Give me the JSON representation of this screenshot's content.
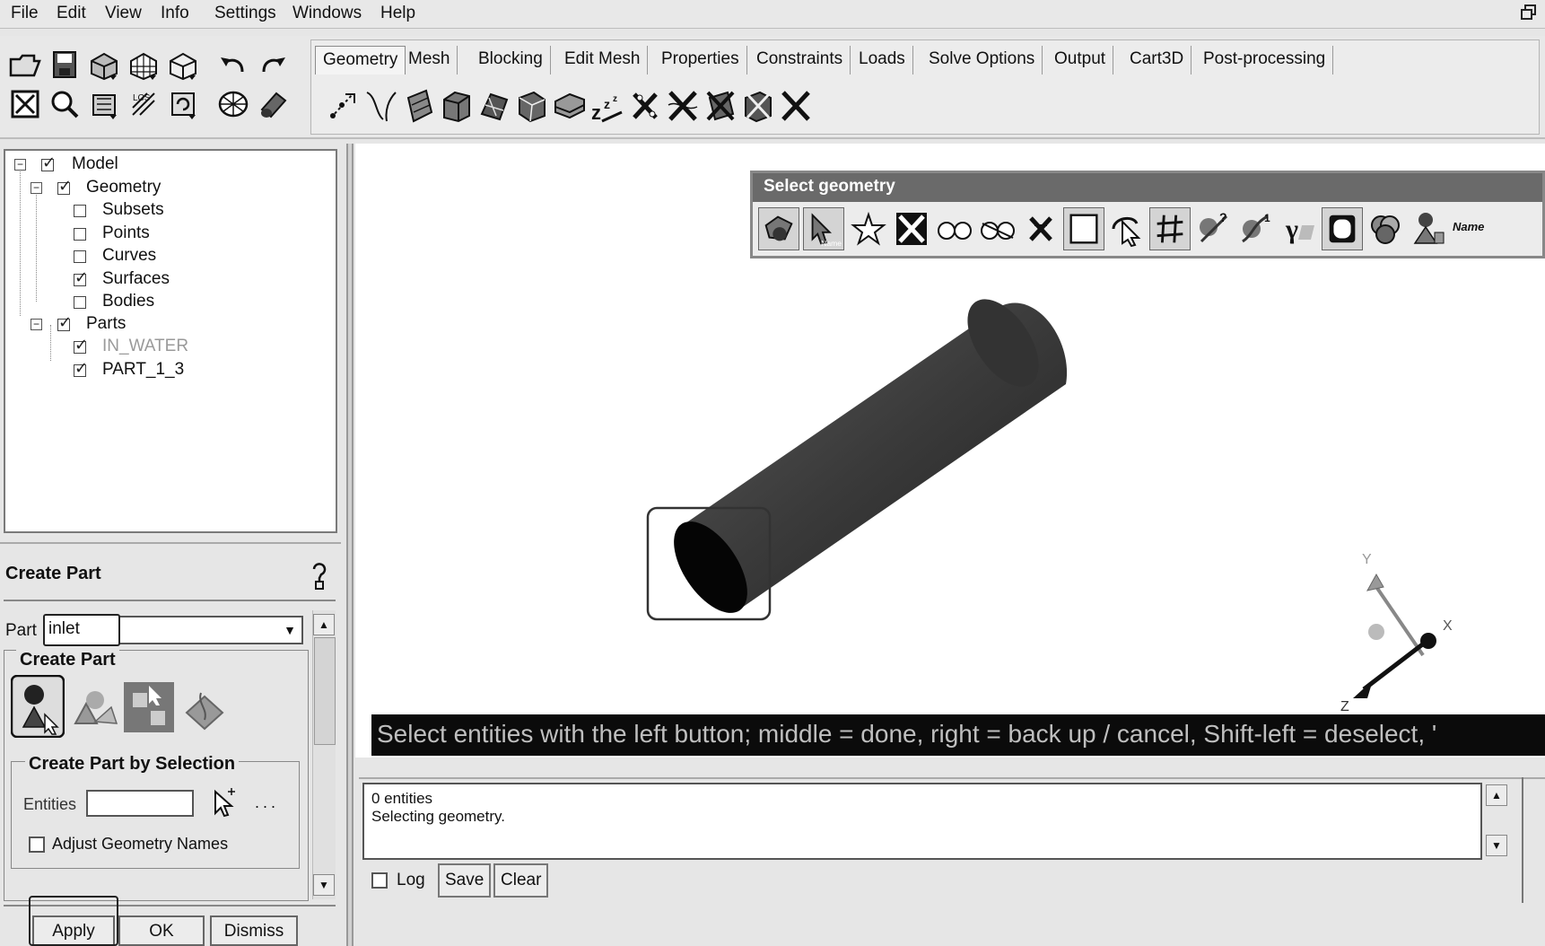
{
  "menu": {
    "items": [
      "File",
      "Edit",
      "View",
      "Info",
      "Settings",
      "Windows",
      "Help"
    ]
  },
  "tabs": [
    "Geometry",
    "Mesh",
    "Blocking",
    "Edit Mesh",
    "Properties",
    "Constraints",
    "Loads",
    "Solve Options",
    "Output",
    "Cart3D",
    "Post-processing"
  ],
  "active_tab": "Geometry",
  "tree": {
    "model": "Model",
    "geometry": "Geometry",
    "subsets": "Subsets",
    "points": "Points",
    "curves": "Curves",
    "surfaces": "Surfaces",
    "bodies": "Bodies",
    "parts": "Parts",
    "part1": "IN_WATER",
    "part2": "PART_1_3"
  },
  "create_part": {
    "header": "Create Part",
    "part_label": "Part",
    "part_value": "inlet",
    "group_label": "Create Part",
    "by_selection_label": "Create Part by Selection",
    "entities_label": "Entities",
    "entities_more": "...",
    "adjust_label": "Adjust Geometry Names",
    "apply": "Apply",
    "ok": "OK",
    "dismiss": "Dismiss"
  },
  "select_geometry": {
    "title": "Select geometry",
    "name_button": "Name"
  },
  "viewport": {
    "status_text": "Select entities with the left button; middle = done, right = back up / cancel, Shift-left = deselect, '",
    "axis_x": "X",
    "axis_y": "Y",
    "axis_z": "Z"
  },
  "messages": {
    "line1": "0 entities",
    "line2": "Selecting geometry.",
    "log_label": "Log",
    "save": "Save",
    "clear": "Clear"
  }
}
